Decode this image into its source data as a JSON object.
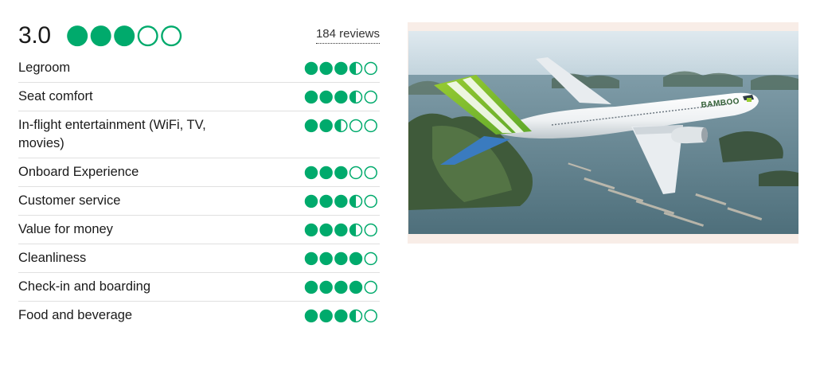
{
  "overall": {
    "score": "3.0",
    "rating": 3,
    "reviews": "184 reviews"
  },
  "categories": [
    {
      "label": "Legroom",
      "rating": 3.5
    },
    {
      "label": "Seat comfort",
      "rating": 3.5
    },
    {
      "label": "In-flight entertainment (WiFi, TV, movies)",
      "rating": 2.5
    },
    {
      "label": "Onboard Experience",
      "rating": 3
    },
    {
      "label": "Customer service",
      "rating": 3.5
    },
    {
      "label": "Value for money",
      "rating": 3.5
    },
    {
      "label": "Cleanliness",
      "rating": 4
    },
    {
      "label": "Check-in and boarding",
      "rating": 4
    },
    {
      "label": "Food and beverage",
      "rating": 3.5
    }
  ],
  "image": {
    "plane_livery_text": "BAMBOO"
  },
  "colors": {
    "bubble_fill": "#00aa6c",
    "divider": "#e0e0e0",
    "text": "#1a1a1a"
  }
}
